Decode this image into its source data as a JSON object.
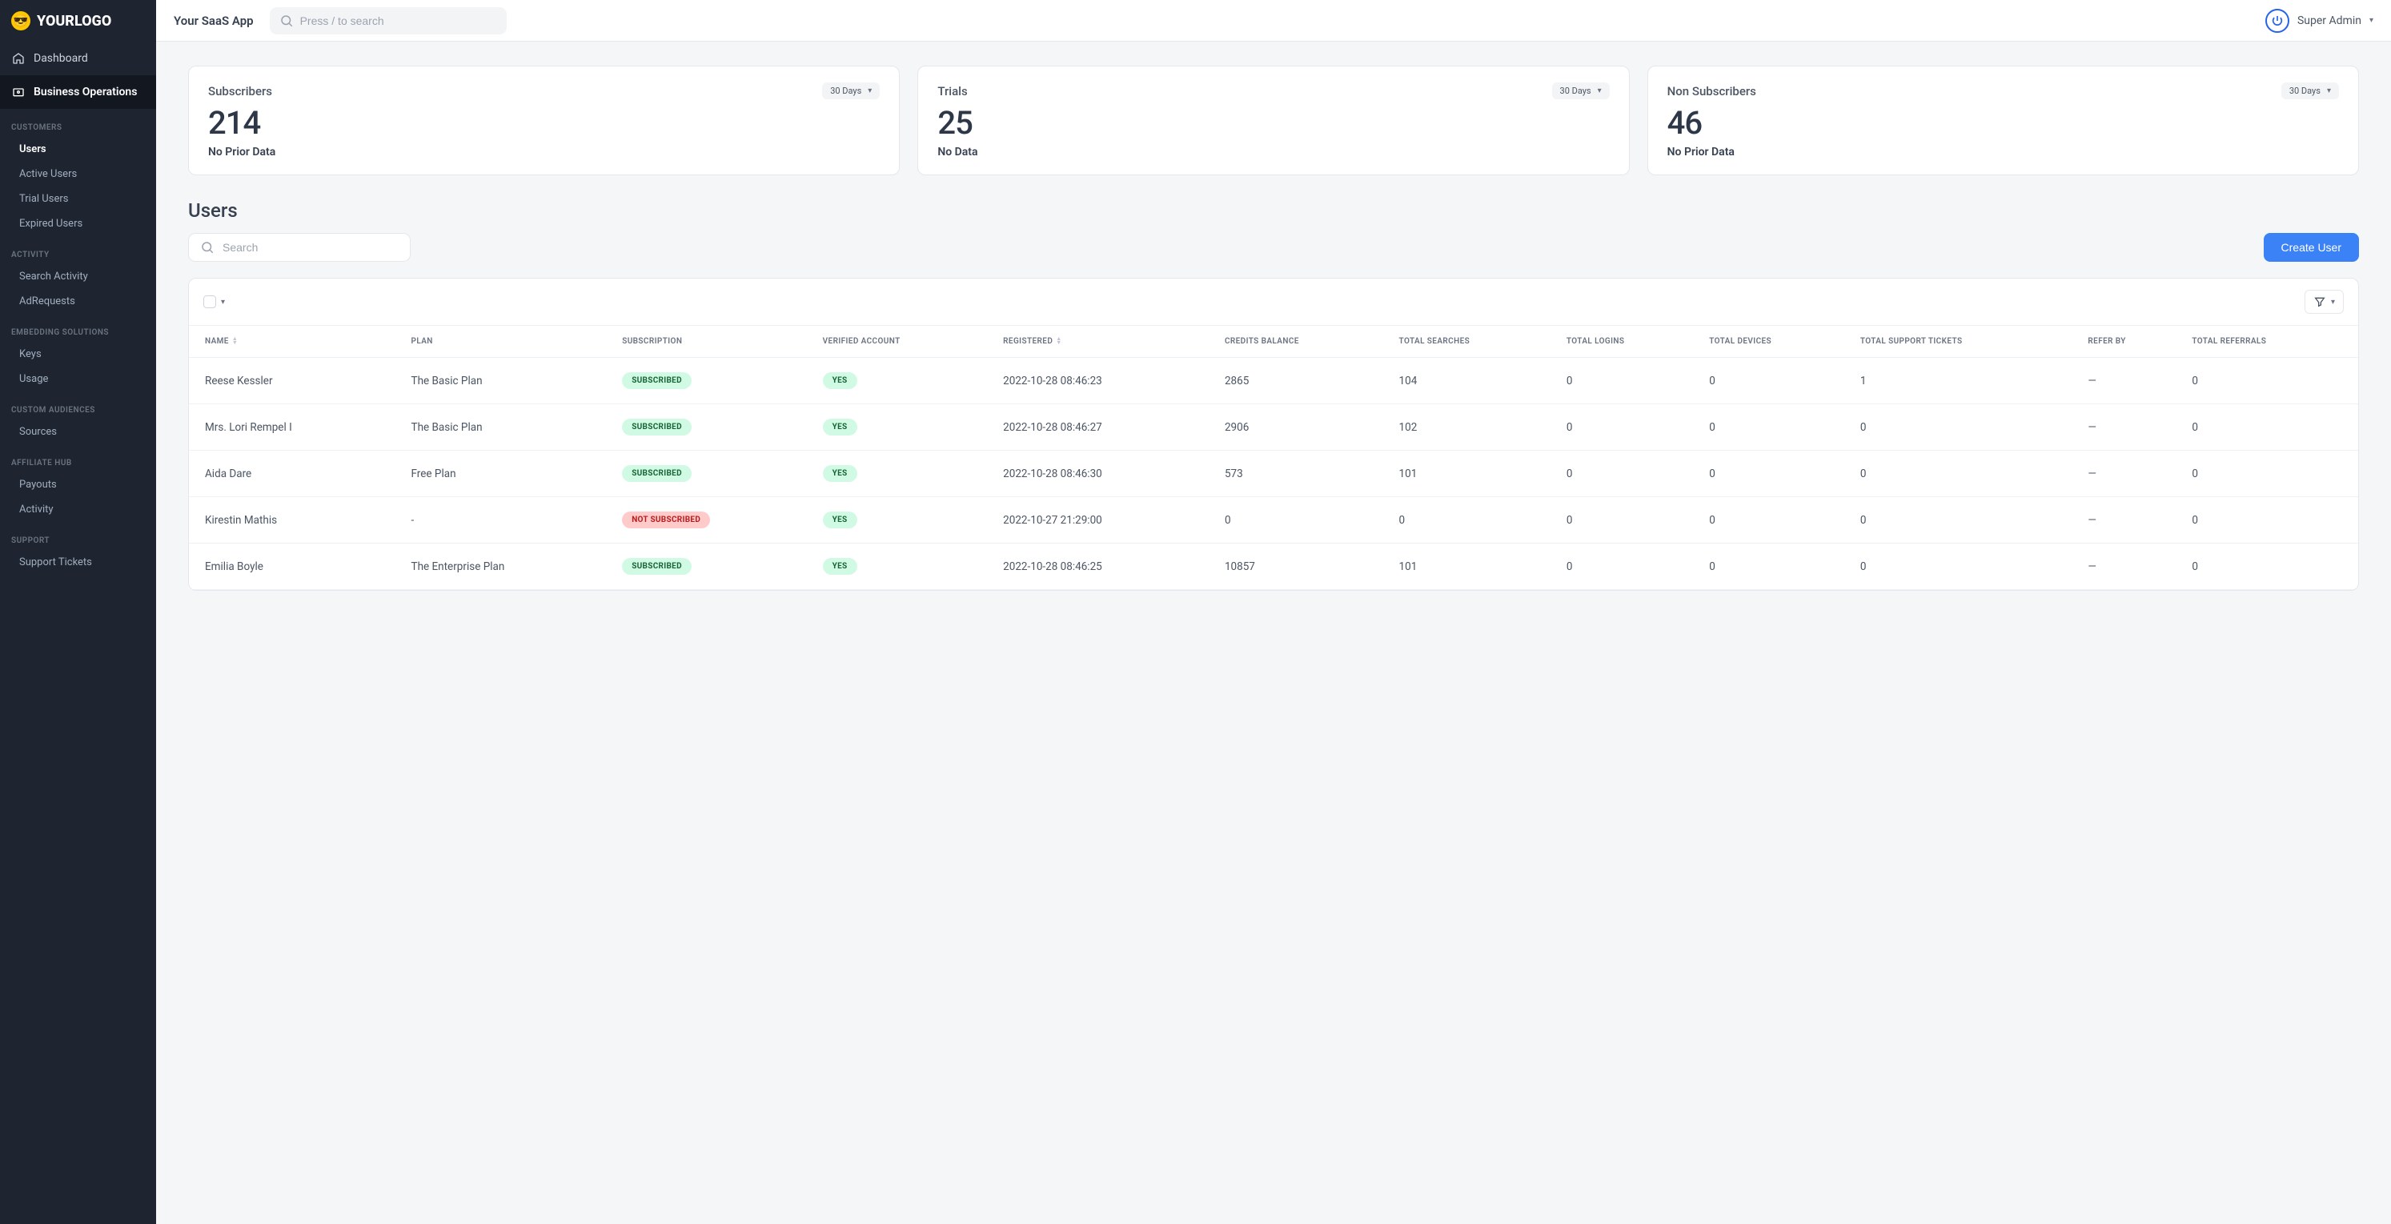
{
  "brand": {
    "logo_text": "YOURLOGO"
  },
  "topbar": {
    "app_title": "Your SaaS App",
    "search_placeholder": "Press / to search",
    "user_name": "Super Admin"
  },
  "sidebar": {
    "items": [
      {
        "label": "Dashboard",
        "icon": "home"
      },
      {
        "label": "Business Operations",
        "icon": "biz"
      }
    ],
    "groups": [
      {
        "heading": "CUSTOMERS",
        "links": [
          {
            "label": "Users",
            "active": true
          },
          {
            "label": "Active Users"
          },
          {
            "label": "Trial Users"
          },
          {
            "label": "Expired Users"
          }
        ]
      },
      {
        "heading": "ACTIVITY",
        "links": [
          {
            "label": "Search Activity"
          },
          {
            "label": "AdRequests"
          }
        ]
      },
      {
        "heading": "EMBEDDING SOLUTIONS",
        "links": [
          {
            "label": "Keys"
          },
          {
            "label": "Usage"
          }
        ]
      },
      {
        "heading": "CUSTOM AUDIENCES",
        "links": [
          {
            "label": "Sources"
          }
        ]
      },
      {
        "heading": "AFFILIATE HUB",
        "links": [
          {
            "label": "Payouts"
          },
          {
            "label": "Activity"
          }
        ]
      },
      {
        "heading": "SUPPORT",
        "links": [
          {
            "label": "Support Tickets"
          }
        ]
      }
    ]
  },
  "stats": [
    {
      "title": "Subscribers",
      "period": "30 Days",
      "value": "214",
      "sub": "No Prior Data"
    },
    {
      "title": "Trials",
      "period": "30 Days",
      "value": "25",
      "sub": "No Data"
    },
    {
      "title": "Non Subscribers",
      "period": "30 Days",
      "value": "46",
      "sub": "No Prior Data"
    }
  ],
  "users": {
    "section_title": "Users",
    "search_placeholder": "Search",
    "create_label": "Create User",
    "columns": [
      "NAME",
      "PLAN",
      "SUBSCRIPTION",
      "VERIFIED ACCOUNT",
      "REGISTERED",
      "CREDITS BALANCE",
      "TOTAL SEARCHES",
      "TOTAL LOGINS",
      "TOTAL DEVICES",
      "TOTAL SUPPORT TICKETS",
      "REFER BY",
      "TOTAL REFERRALS"
    ],
    "rows": [
      {
        "name": "Reese Kessler",
        "plan": "The Basic Plan",
        "sub": "SUBSCRIBED",
        "sub_style": "green",
        "verified": "YES",
        "registered": "2022-10-28 08:46:23",
        "credits": "2865",
        "searches": "104",
        "logins": "0",
        "devices": "0",
        "tickets": "1",
        "refer": "—",
        "referrals": "0"
      },
      {
        "name": "Mrs. Lori Rempel I",
        "plan": "The Basic Plan",
        "sub": "SUBSCRIBED",
        "sub_style": "green",
        "verified": "YES",
        "registered": "2022-10-28 08:46:27",
        "credits": "2906",
        "searches": "102",
        "logins": "0",
        "devices": "0",
        "tickets": "0",
        "refer": "—",
        "referrals": "0"
      },
      {
        "name": "Aida Dare",
        "plan": "Free Plan",
        "sub": "SUBSCRIBED",
        "sub_style": "green",
        "verified": "YES",
        "registered": "2022-10-28 08:46:30",
        "credits": "573",
        "searches": "101",
        "logins": "0",
        "devices": "0",
        "tickets": "0",
        "refer": "—",
        "referrals": "0"
      },
      {
        "name": "Kirestin Mathis",
        "plan": "-",
        "sub": "NOT SUBSCRIBED",
        "sub_style": "red",
        "verified": "YES",
        "registered": "2022-10-27 21:29:00",
        "credits": "0",
        "searches": "0",
        "logins": "0",
        "devices": "0",
        "tickets": "0",
        "refer": "—",
        "referrals": "0"
      },
      {
        "name": "Emilia Boyle",
        "plan": "The Enterprise Plan",
        "sub": "SUBSCRIBED",
        "sub_style": "green",
        "verified": "YES",
        "registered": "2022-10-28 08:46:25",
        "credits": "10857",
        "searches": "101",
        "logins": "0",
        "devices": "0",
        "tickets": "0",
        "refer": "—",
        "referrals": "0"
      }
    ]
  }
}
